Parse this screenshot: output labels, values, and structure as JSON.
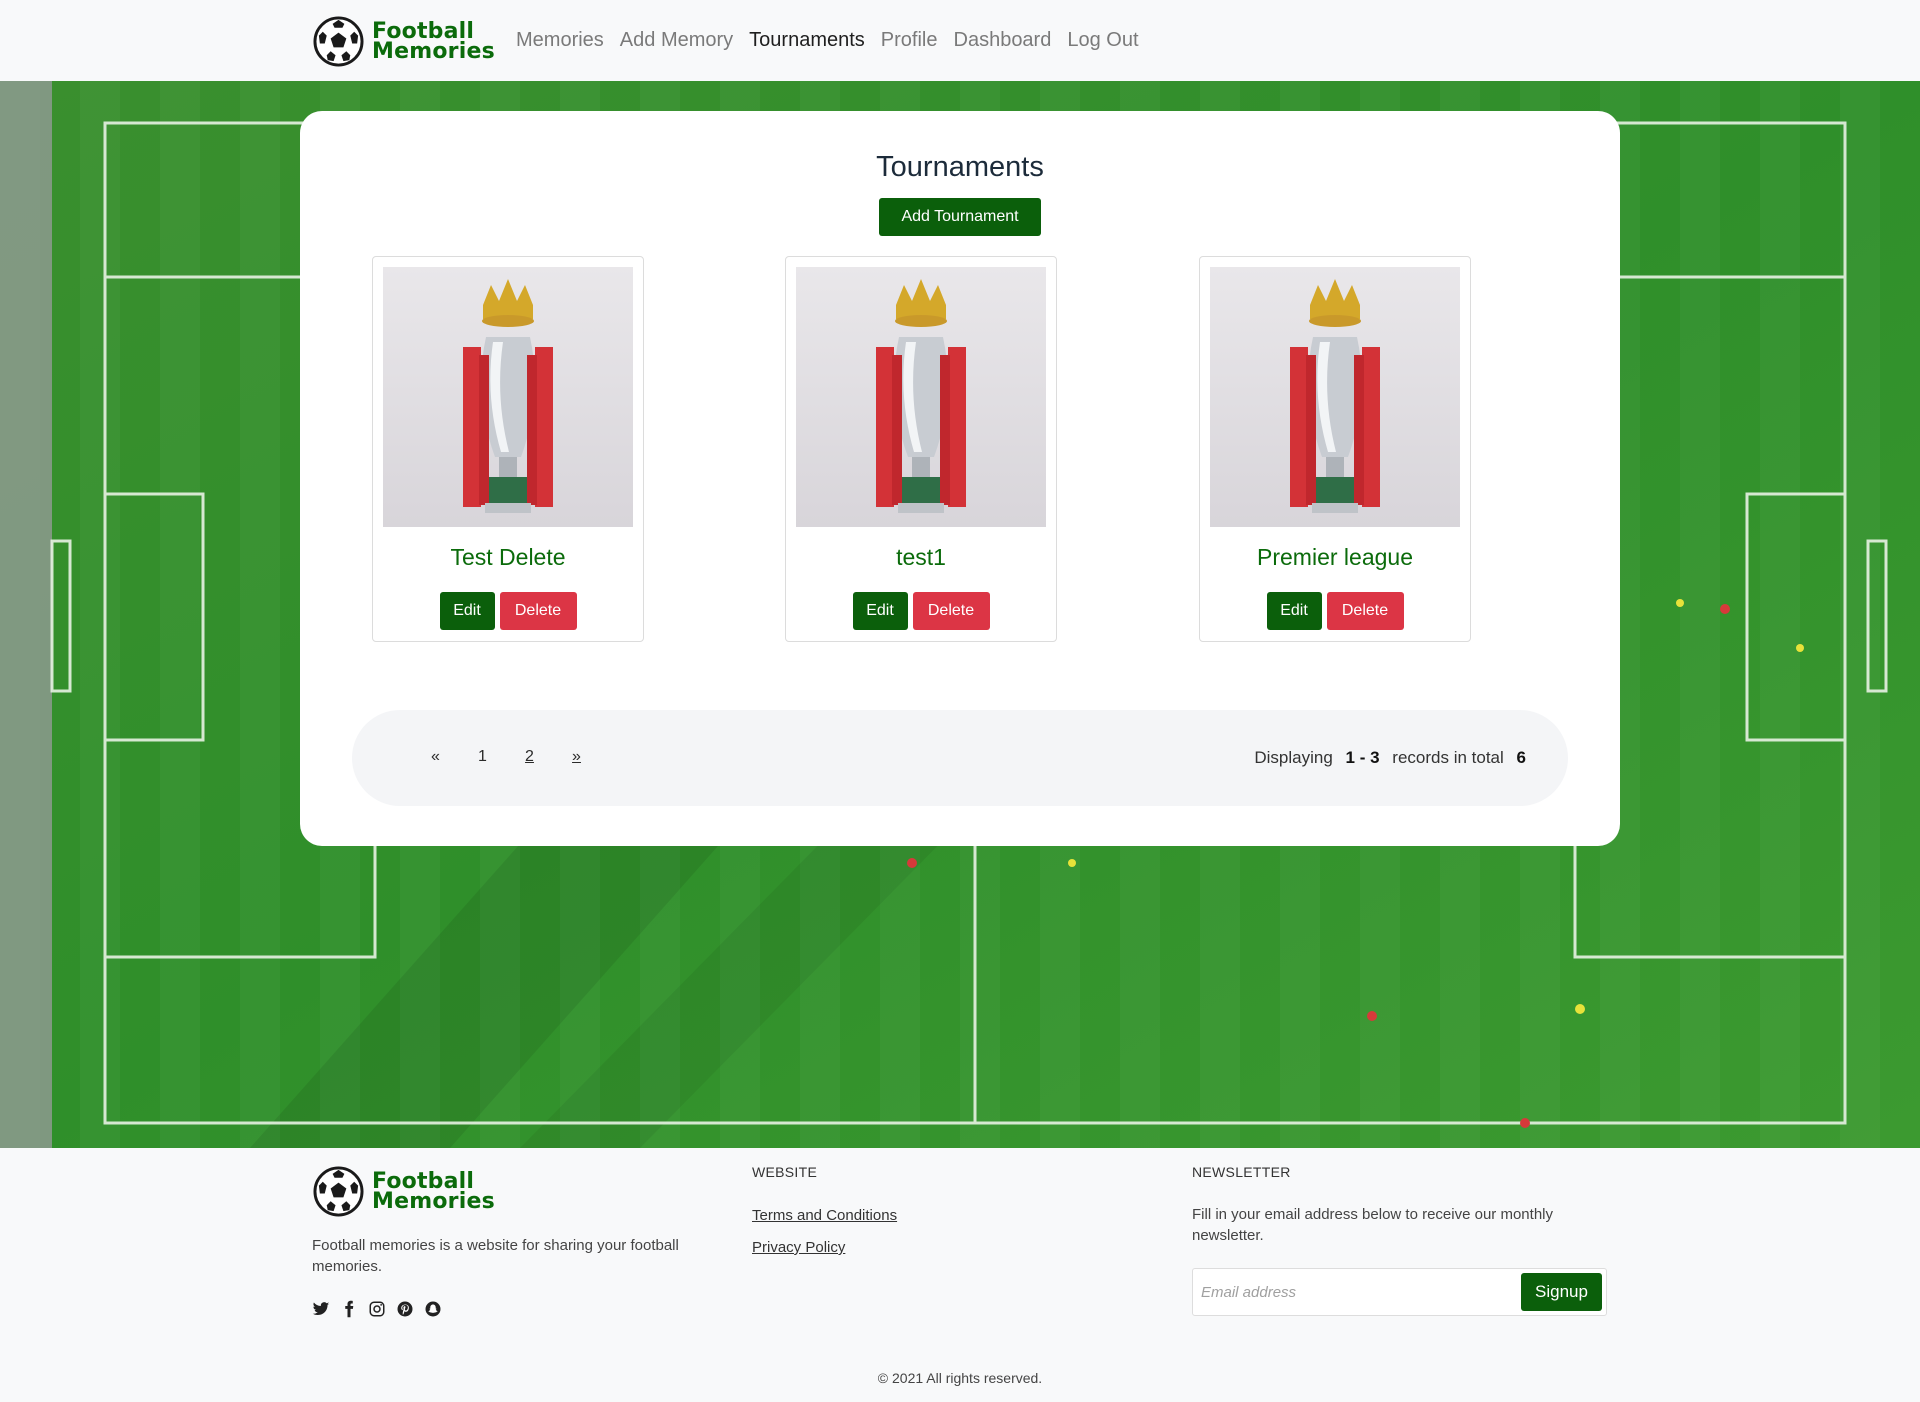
{
  "brand": {
    "line1": "Football",
    "line2": "Memories"
  },
  "nav": [
    {
      "label": "Memories",
      "active": false
    },
    {
      "label": "Add Memory",
      "active": false
    },
    {
      "label": "Tournaments",
      "active": true
    },
    {
      "label": "Profile",
      "active": false
    },
    {
      "label": "Dashboard",
      "active": false
    },
    {
      "label": "Log Out",
      "active": false
    }
  ],
  "main": {
    "title": "Tournaments",
    "add_button": "Add Tournament",
    "cards": [
      {
        "name": "Test Delete",
        "edit": "Edit",
        "delete": "Delete"
      },
      {
        "name": "test1",
        "edit": "Edit",
        "delete": "Delete"
      },
      {
        "name": "Premier league",
        "edit": "Edit",
        "delete": "Delete"
      }
    ]
  },
  "pagination": {
    "prev": "«",
    "pages": [
      "1",
      "2"
    ],
    "next": "»",
    "info_prefix": "Displaying",
    "range": "1 - 3",
    "info_middle": "records in total",
    "total": "6"
  },
  "footer": {
    "description": "Football memories is a website for sharing your football memories.",
    "website_heading": "WEBSITE",
    "links": [
      "Terms and Conditions",
      "Privacy Policy"
    ],
    "newsletter_heading": "NEWSLETTER",
    "newsletter_text": "Fill in your email address below to receive our monthly newsletter.",
    "email_placeholder": "Email address",
    "signup_label": "Signup",
    "social_icons": [
      "twitter-icon",
      "facebook-icon",
      "instagram-icon",
      "pinterest-icon",
      "snapchat-icon"
    ],
    "copyright": "© 2021 All rights reserved."
  },
  "colors": {
    "brand_green": "#0b6b0b",
    "button_green": "#0b5f0b",
    "delete_red": "#dc3545",
    "pitch_green": "#2f8f2a"
  }
}
